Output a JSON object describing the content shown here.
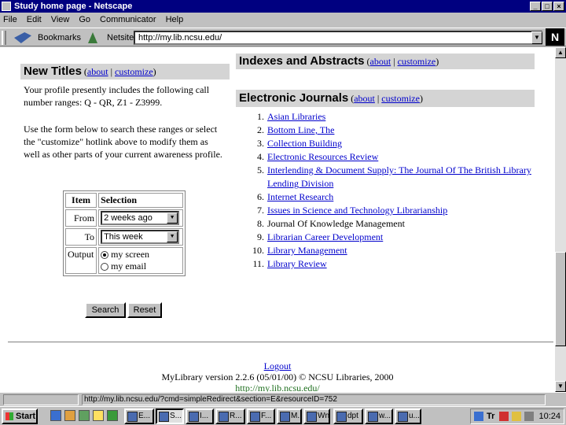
{
  "window": {
    "title": "Study home page - Netscape"
  },
  "menu": [
    "File",
    "Edit",
    "View",
    "Go",
    "Communicator",
    "Help"
  ],
  "toolbar": {
    "bookmarks_label": "Bookmarks",
    "netsite_label": "Netsite:",
    "url": "http://my.lib.ncsu.edu/"
  },
  "new_titles": {
    "heading": "New Titles",
    "links_open": "(",
    "about": "about",
    "sep": "|",
    "customize": "customize",
    "links_close": ")",
    "intro": "Your profile presently includes the following call number ranges: Q - QR, Z1 - Z3999.",
    "instructions": "Use the form below to search these ranges or select the \"customize\" hotlink above to modify them as well as other parts of your current awareness profile.",
    "table": {
      "col_item": "Item",
      "col_selection": "Selection",
      "from_label": "From",
      "from_value": "2 weeks ago",
      "to_label": "To",
      "to_value": "This week",
      "output_label": "Output",
      "opt_screen": "my screen",
      "opt_email": "my email"
    },
    "search_button": "Search",
    "reset_button": "Reset"
  },
  "indexes": {
    "heading": "Indexes and Abstracts",
    "about": "about",
    "customize": "customize"
  },
  "journals": {
    "heading": "Electronic Journals",
    "about": "about",
    "customize": "customize",
    "items": [
      {
        "num": "1.",
        "title": "Asian Libraries",
        "link": true
      },
      {
        "num": "2.",
        "title": "Bottom Line, The",
        "link": true
      },
      {
        "num": "3.",
        "title": "Collection Building",
        "link": true
      },
      {
        "num": "4.",
        "title": "Electronic Resources Review",
        "link": true
      },
      {
        "num": "5.",
        "title": "Interlending & Document Supply: The Journal Of The British Library Lending Division",
        "link": true
      },
      {
        "num": "6.",
        "title": "Internet Research",
        "link": true
      },
      {
        "num": "7.",
        "title": "Issues in Science and Technology Librarianship",
        "link": true
      },
      {
        "num": "8.",
        "title": "Journal Of Knowledge Management",
        "link": false
      },
      {
        "num": "9.",
        "title": "Librarian Career Development",
        "link": true
      },
      {
        "num": "10.",
        "title": "Library Management",
        "link": true
      },
      {
        "num": "11.",
        "title": "Library Review",
        "link": true
      }
    ]
  },
  "footer": {
    "logout": "Logout",
    "version": "MyLibrary version 2.2.6 (05/01/00) © NCSU Libraries, 2000",
    "url": "http://my.lib.ncsu.edu/"
  },
  "status": {
    "text": "http://my.lib.ncsu.edu/?cmd=simpleRedirect&section=E&resourceID=752"
  },
  "taskbar": {
    "start": "Start",
    "tasks": [
      "E...",
      "S...",
      "I...",
      "R...",
      "F...",
      "M...",
      "Wn...",
      "dpt",
      "w...",
      "u..."
    ],
    "tray_label": "Tr",
    "clock": "10:24"
  }
}
